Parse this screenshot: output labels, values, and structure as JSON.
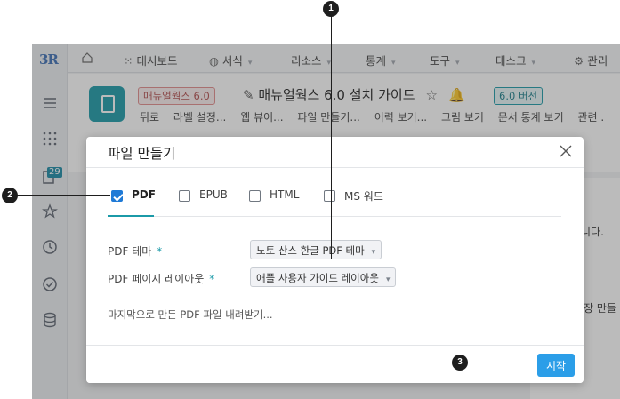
{
  "app": {
    "logo": "3R",
    "leftbar_badge": "29"
  },
  "topnav": {
    "items": [
      {
        "label": "대시보드"
      },
      {
        "label": "서식"
      },
      {
        "label": "리소스"
      },
      {
        "label": "통계"
      },
      {
        "label": "도구"
      },
      {
        "label": "태스크"
      },
      {
        "label": "관리"
      }
    ]
  },
  "page": {
    "book_tag": "매뉴얼웍스 6.0",
    "title": "매뉴얼웍스 6.0 설치 가이드",
    "version_tag": "6.0 버전",
    "actions": [
      "뒤로",
      "라벨 설정...",
      "웹 뷰어...",
      "파일 만들기...",
      "이력 보기...",
      "그림 보기",
      "문서 통계 보기",
      "관련 ."
    ],
    "bg_fragments": [
      "니다.",
      "장 만들"
    ]
  },
  "dialog": {
    "title": "파일 만들기",
    "formats": [
      {
        "label": "PDF",
        "checked": true
      },
      {
        "label": "EPUB",
        "checked": false
      },
      {
        "label": "HTML",
        "checked": false
      },
      {
        "label": "MS 워드",
        "checked": false
      }
    ],
    "pdf_theme_label": "PDF 테마",
    "pdf_theme_value": "노토 산스 한글 PDF 테마",
    "pdf_layout_label": "PDF 페이지 레이아웃",
    "pdf_layout_value": "애플 사용자 가이드 레이아웃",
    "required_mark": "*",
    "download_last": "마지막으로 만든 PDF 파일 내려받기...",
    "start_button": "시작"
  },
  "callouts": [
    "1",
    "2",
    "3"
  ],
  "colors": {
    "accent": "#1b9aa8",
    "primary_button": "#2b9ee8",
    "book_tag": "#e28d8d"
  }
}
